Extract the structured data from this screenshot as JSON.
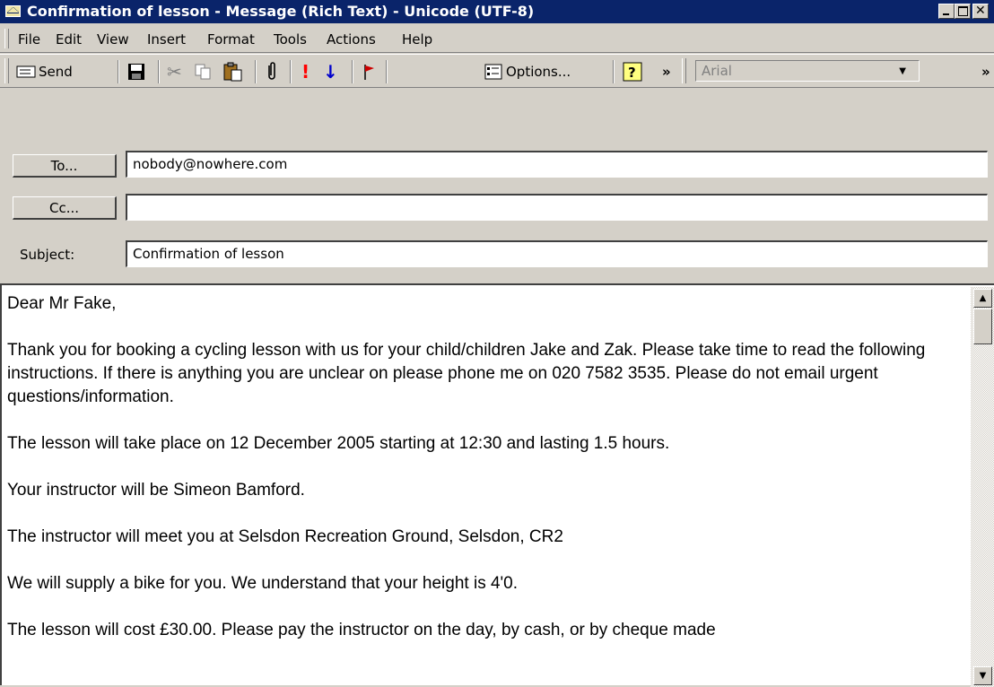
{
  "window": {
    "title": "Confirmation of lesson - Message (Rich Text)  - Unicode (UTF-8)"
  },
  "menu": [
    "File",
    "Edit",
    "View",
    "Insert",
    "Format",
    "Tools",
    "Actions",
    "Help"
  ],
  "toolbar": {
    "send_label": "Send",
    "options_label": "Options...",
    "more_glyph": "»",
    "font_name": "Arial",
    "icons": [
      "send-icon",
      "save-icon",
      "cut-icon",
      "copy-icon",
      "paste-icon",
      "attach-icon",
      "high-importance-icon",
      "low-importance-icon",
      "flag-icon",
      "options-icon",
      "help-icon"
    ]
  },
  "header": {
    "to_label": "To...",
    "to_value": "nobody@nowhere.com",
    "cc_label": "Cc...",
    "cc_value": "",
    "subject_label": "Subject:",
    "subject_value": "Confirmation of lesson"
  },
  "body": {
    "paragraphs": [
      "Dear Mr Fake,",
      "Thank you for booking a cycling lesson with us for your child/children Jake and Zak. Please take time to read the following instructions. If there is anything you are unclear on please phone me on 020 7582 3535. Please do not email urgent questions/information.",
      "The lesson will take place on 12 December 2005 starting at 12:30 and lasting  1.5 hours.",
      "Your instructor will be Simeon Bamford.",
      "The instructor will meet you at Selsdon Recreation Ground, Selsdon, CR2",
      "We will supply a bike for you. We understand that your height is 4'0.",
      "The lesson will cost £30.00. Please pay the instructor on the day, by cash, or by cheque made"
    ]
  },
  "colors": {
    "titlebar": "#0a246a",
    "chrome": "#d4d0c8",
    "importance_high": "#ff0000",
    "importance_low": "#0000cc",
    "flag": "#cc0000"
  }
}
